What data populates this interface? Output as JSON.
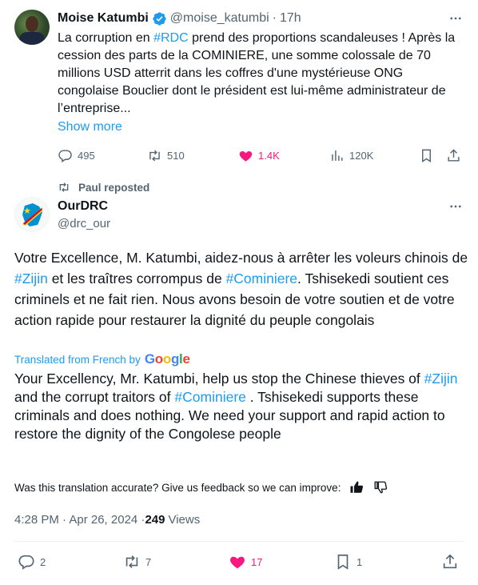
{
  "tweet1": {
    "author_name": "Moise Katumbi",
    "handle": "@moise_katumbi",
    "separator": "·",
    "time": "17h",
    "body": {
      "p1": "La corruption en ",
      "tag1": "#RDC",
      "p2": " prend des proportions scandaleuses ! Après la cession des parts de la COMINIERE, une somme colossale de 70 millions USD atterrit dans les coffres d'une mystérieuse ONG congolaise Bouclier dont le président est lui-même administrateur de l’entreprise..."
    },
    "show_more": "Show more",
    "stats": {
      "replies": "495",
      "reposts": "510",
      "likes": "1.4K",
      "views": "120K"
    }
  },
  "repost": {
    "label": "Paul reposted"
  },
  "tweet2": {
    "author_name": "OurDRC",
    "handle": "@drc_our",
    "original": {
      "p1": "Votre Excellence, M. Katumbi, aidez-nous à arrêter les voleurs chinois de ",
      "tag1": "#Zijin",
      "p2": " et les traîtres corrompus de ",
      "tag2": "#Cominiere",
      "p3": ". Tshisekedi soutient ces criminels et ne fait rien. Nous avons besoin de votre soutien et de votre action rapide pour restaurer la dignité du peuple congolais"
    },
    "translated_label": "Translated from French by",
    "google": {
      "G": "G",
      "o1": "o",
      "o2": "o",
      "g": "g",
      "l": "l",
      "e": "e"
    },
    "translation": {
      "p1": "Your Excellency, Mr. Katumbi, help us stop the Chinese thieves of ",
      "tag1": "#Zijin",
      "p2": " and the corrupt traitors of ",
      "tag2": "#Cominiere",
      "p3": " . Tshisekedi supports these criminals and does nothing. We need your support and rapid action to restore the dignity of the Congolese people"
    },
    "feedback_question": "Was this translation accurate? Give us feedback so we can improve:",
    "timestamp": "4:28 PM · Apr 26, 2024 · ",
    "views_count": "249",
    "views_label": "Views",
    "stats": {
      "replies": "2",
      "reposts": "7",
      "likes": "17",
      "bookmarks": "1"
    }
  },
  "colors": {
    "accent": "#1d9bf0",
    "like_pink": "#f91880",
    "secondary_text": "#536471"
  },
  "icons": [
    "verified-badge-icon",
    "more-icon",
    "reply-icon",
    "repost-icon",
    "heart-icon",
    "views-icon",
    "bookmark-icon",
    "share-icon",
    "thumbs-up-icon",
    "thumbs-down-icon"
  ]
}
